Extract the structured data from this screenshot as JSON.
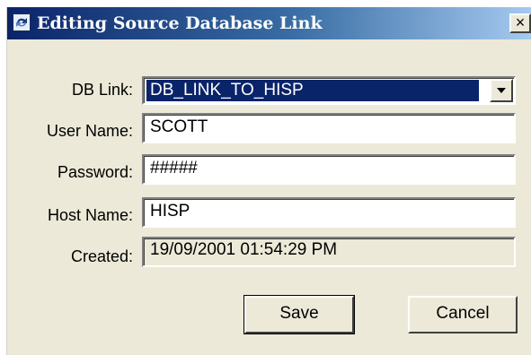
{
  "window": {
    "title": "Editing Source Database Link",
    "close_label": "×"
  },
  "form": {
    "db_link": {
      "label": "DB Link:",
      "value": "DB_LINK_TO_HISP"
    },
    "user_name": {
      "label": "User Name:",
      "value": "SCOTT"
    },
    "password": {
      "label": "Password:",
      "value": "#####"
    },
    "host_name": {
      "label": "Host Name:",
      "value": "HISP"
    },
    "created": {
      "label": "Created:",
      "value": "19/09/2001 01:54:29 PM"
    }
  },
  "buttons": {
    "save_label": "Save",
    "cancel_label": "Cancel"
  },
  "colors": {
    "title_start": "#0a246a",
    "title_end": "#a6caf0",
    "dialog_face": "#ece9d8",
    "selection": "#0a246a"
  },
  "icons": {
    "app": "app-window-icon",
    "close": "close-icon",
    "dropdown": "chevron-down-icon"
  }
}
